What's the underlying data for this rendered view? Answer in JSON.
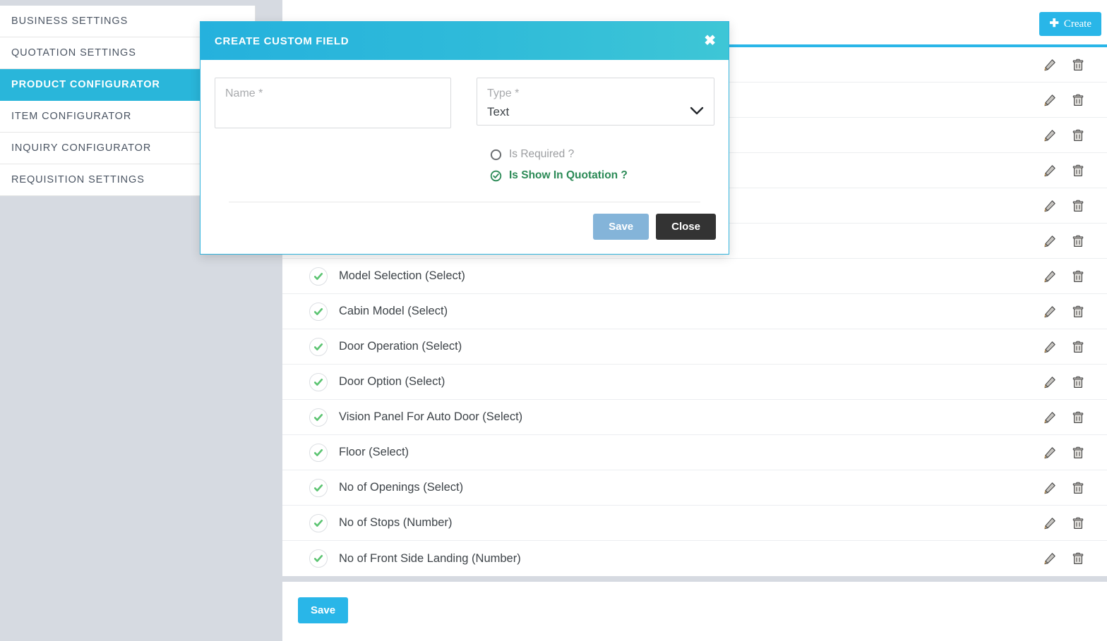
{
  "sidebar": {
    "items": [
      {
        "label": "BUSINESS  SETTINGS",
        "active": false
      },
      {
        "label": "QUOTATION  SETTINGS",
        "active": false
      },
      {
        "label": "PRODUCT  CONFIGURATOR",
        "active": true
      },
      {
        "label": "ITEM  CONFIGURATOR",
        "active": false
      },
      {
        "label": "INQUIRY  CONFIGURATOR",
        "active": false
      },
      {
        "label": "REQUISITION  SETTINGS",
        "active": false
      }
    ]
  },
  "header": {
    "create_label": "Create",
    "create_icon": "plus-icon",
    "plus_glyph": "✚"
  },
  "list": {
    "row_icon": "check-circle-icon",
    "edit_icon": "pencil-icon",
    "delete_icon": "trash-icon",
    "rows": [
      {
        "label": "",
        "hidden_by_modal": true
      },
      {
        "label": "",
        "hidden_by_modal": true
      },
      {
        "label": "",
        "hidden_by_modal": true
      },
      {
        "label": "",
        "hidden_by_modal": true
      },
      {
        "label": "",
        "hidden_by_modal": true
      },
      {
        "label": "",
        "hidden_by_modal": true
      },
      {
        "label": "Model Selection (Select)",
        "hidden_by_modal": false
      },
      {
        "label": "Cabin Model (Select)",
        "hidden_by_modal": false
      },
      {
        "label": "Door Operation (Select)",
        "hidden_by_modal": false
      },
      {
        "label": "Door Option (Select)",
        "hidden_by_modal": false
      },
      {
        "label": "Vision Panel For Auto Door (Select)",
        "hidden_by_modal": false
      },
      {
        "label": "Floor (Select)",
        "hidden_by_modal": false
      },
      {
        "label": "No of Openings (Select)",
        "hidden_by_modal": false
      },
      {
        "label": "No of Stops (Number)",
        "hidden_by_modal": false
      },
      {
        "label": "No of Front Side Landing (Number)",
        "hidden_by_modal": false
      }
    ]
  },
  "footer": {
    "save_label": "Save"
  },
  "modal": {
    "title": "CREATE CUSTOM FIELD",
    "close_icon": "close-x-icon",
    "close_glyph": "✖",
    "name_field": {
      "label": "Name *",
      "placeholder": "Name *",
      "value": ""
    },
    "type_field": {
      "label": "Type *",
      "value": "Text",
      "chevron_icon": "chevron-down-icon"
    },
    "options": [
      {
        "label": "Is Required ?",
        "checked": false,
        "icon": "radio-circle-empty-icon"
      },
      {
        "label": "Is Show In Quotation ?",
        "checked": true,
        "icon": "check-circle-icon"
      }
    ],
    "save_label": "Save",
    "close_label": "Close"
  },
  "colors": {
    "accent": "#29b6e8",
    "accent_header_left": "#25b1dd",
    "accent_header_right": "#3ec6d6",
    "page_background": "#d6dae1",
    "panel": "#ffffff",
    "green_check": "#5cc472",
    "green_text": "#2b8a56",
    "modal_save": "#84b4d9",
    "modal_close": "#333333",
    "muted_text": "#a8aaad",
    "body_text": "#3d4348"
  }
}
